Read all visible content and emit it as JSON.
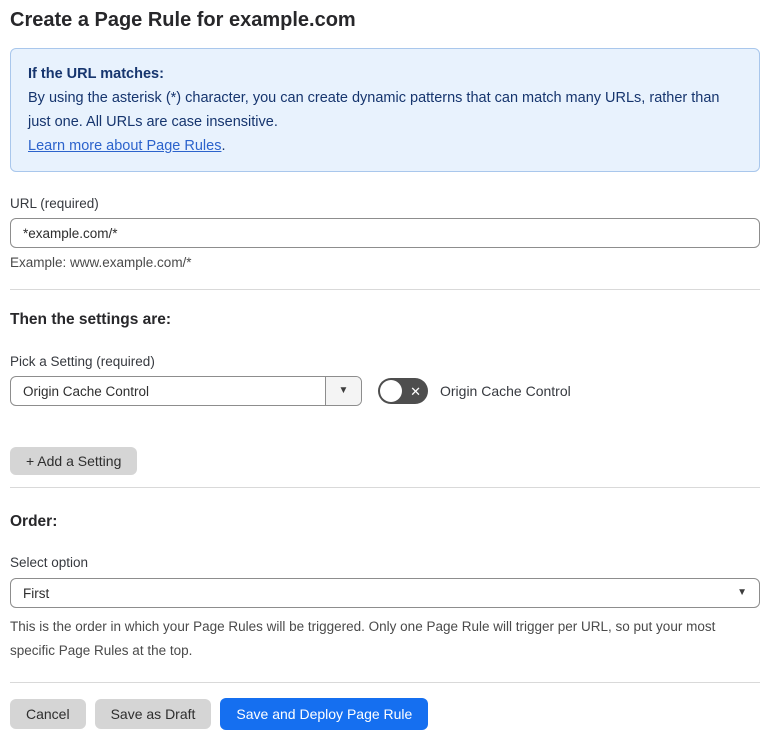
{
  "page": {
    "title": "Create a Page Rule for example.com"
  },
  "info_box": {
    "heading": "If the URL matches:",
    "body": "By using the asterisk (*) character, you can create dynamic patterns that can match many URLs, rather than just one. All URLs are case insensitive.",
    "link_label": "Learn more about Page Rules",
    "link_suffix": "."
  },
  "url_field": {
    "label": "URL (required)",
    "value": "*example.com/*",
    "helper": "Example: www.example.com/*"
  },
  "settings_section": {
    "heading": "Then the settings are:",
    "picker_label": "Pick a Setting (required)",
    "picker_value": "Origin Cache Control",
    "toggle_label": "Origin Cache Control",
    "toggle_state": "off",
    "add_setting_label": "+ Add a Setting"
  },
  "order_section": {
    "heading": "Order:",
    "select_label": "Select option",
    "select_value": "First",
    "helper": "This is the order in which your Page Rules will be triggered. Only one Page Rule will trigger per URL, so put your most specific Page Rules at the top."
  },
  "footer": {
    "cancel_label": "Cancel",
    "save_draft_label": "Save as Draft",
    "save_deploy_label": "Save and Deploy Page Rule"
  },
  "icons": {
    "dropdown_arrow": "▼",
    "toggle_off_x": "✕"
  },
  "colors": {
    "info_bg": "#e8f2fd",
    "info_border": "#a9c7ec",
    "info_text": "#16356e",
    "link_blue": "#2c63cc",
    "primary_blue": "#156ff0",
    "toggle_off_gray": "#4e4e4e",
    "button_gray": "#d5d5d5"
  }
}
